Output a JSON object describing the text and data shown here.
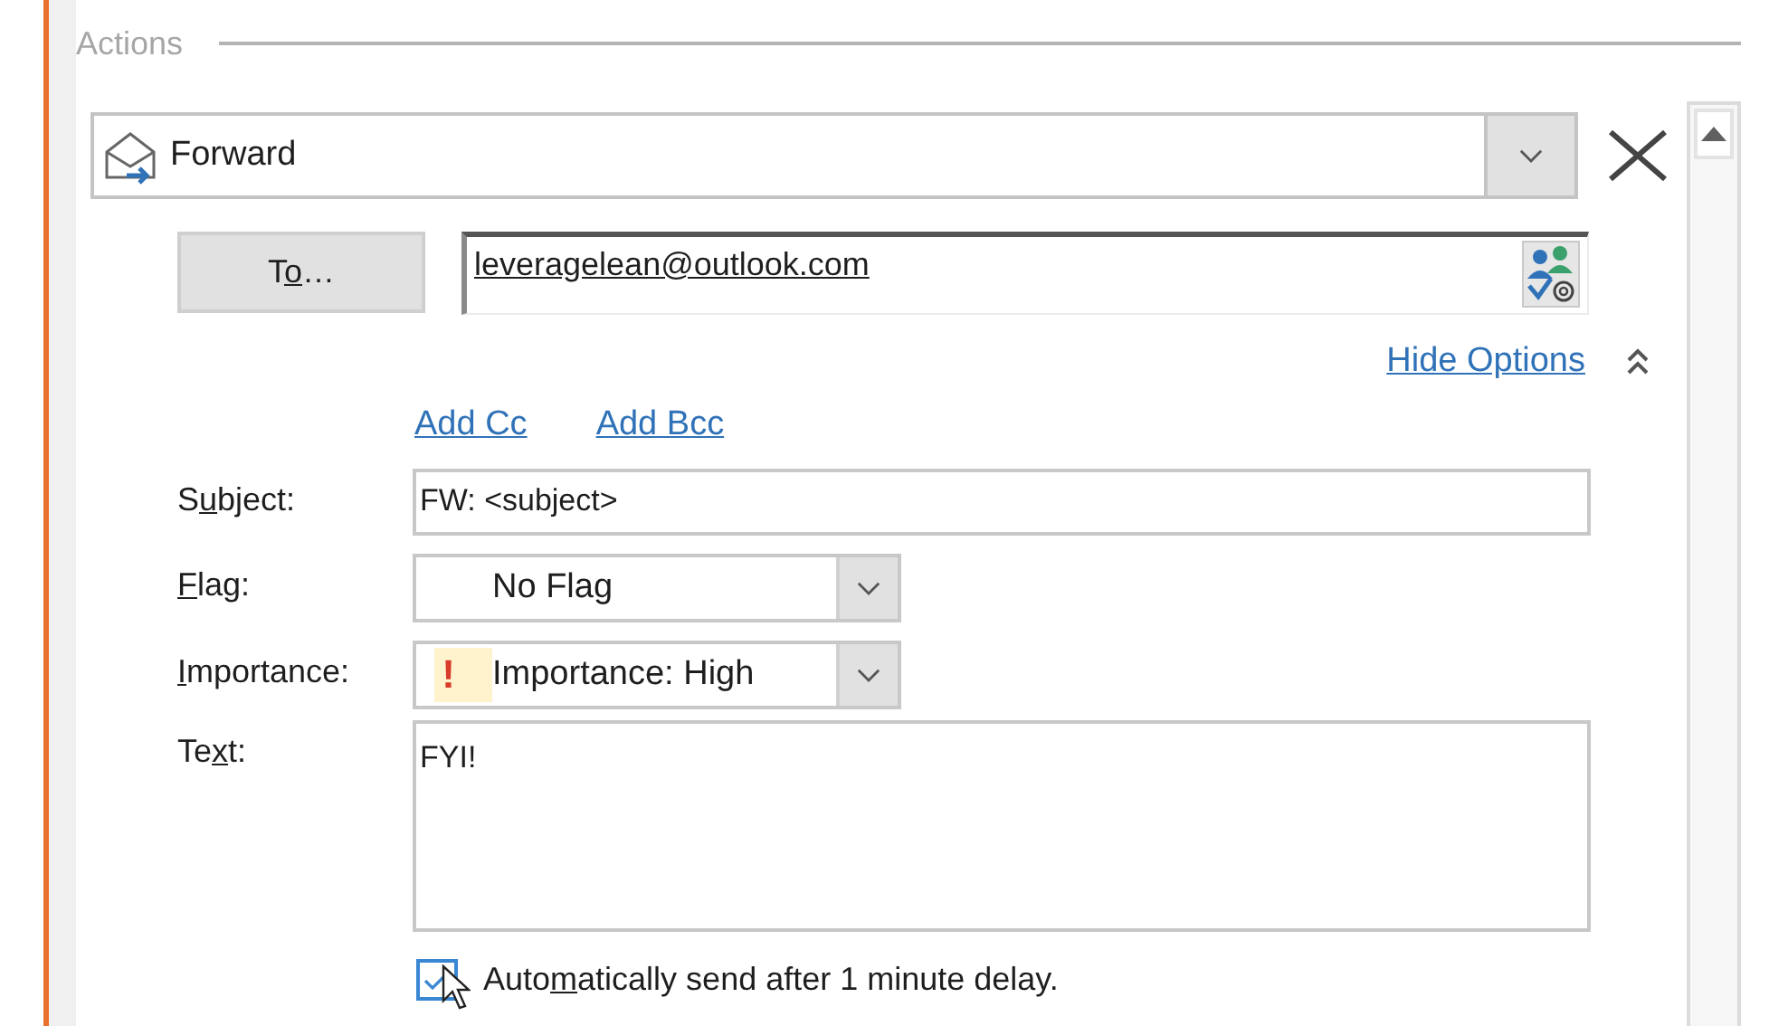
{
  "section": {
    "legend": "Actions"
  },
  "action": {
    "value": "Forward"
  },
  "recipient": {
    "button": {
      "before": "T",
      "key": "o",
      "after": "…"
    },
    "value": "leveragelean@outlook.com"
  },
  "options_link": "Hide Options",
  "copy_links": [
    "Add Cc",
    "Add Bcc"
  ],
  "fields": [
    {
      "kind": "text",
      "label": {
        "before": "S",
        "key": "u",
        "after": "bject:"
      },
      "value": "FW: <subject>"
    },
    {
      "kind": "dropdown",
      "label": {
        "key": "F",
        "after": "lag:"
      },
      "value": "No Flag"
    },
    {
      "kind": "dropdown",
      "label": {
        "key": "I",
        "after": "mportance:"
      },
      "value": "Importance: High",
      "marker": "!"
    },
    {
      "kind": "textarea",
      "label": {
        "before": "Te",
        "key": "x",
        "after": "t:"
      },
      "value": "FYI!"
    }
  ],
  "auto_send": {
    "label": {
      "before": "Auto",
      "key": "m",
      "after": "atically send after 1 minute delay."
    },
    "checked": true
  }
}
